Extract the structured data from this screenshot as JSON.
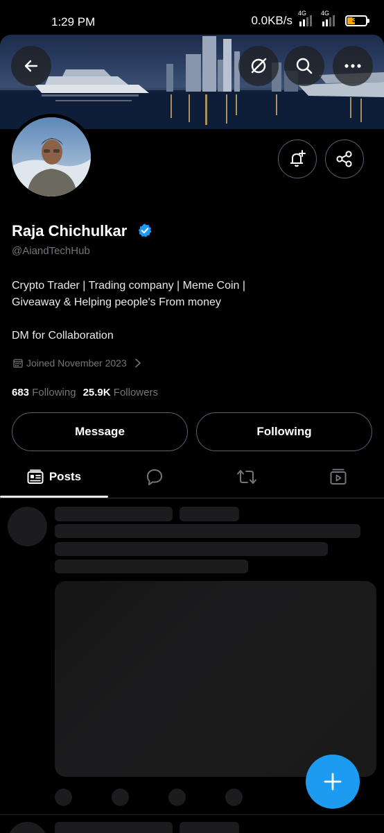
{
  "status_bar": {
    "time": "1:29 PM",
    "speed": "0.0KB/s",
    "network1": "4G",
    "network2": "4G",
    "battery": "35"
  },
  "header": {
    "back_icon": "arrow-left-icon",
    "grok_icon": "grok-icon",
    "search_icon": "search-icon",
    "more_icon": "more-horizontal-icon"
  },
  "profile": {
    "display_name": "Raja Chichulkar",
    "handle": "@AiandTechHub",
    "bio_line1": "Crypto Trader | Trading company | Meme Coin |",
    "bio_line2": "Giveaway & Helping people's From money",
    "bio_line3": "DM for Collaboration",
    "joined": "Joined November 2023",
    "following_count": "683",
    "following_label": "Following",
    "followers_count": "25.9K",
    "followers_label": "Followers"
  },
  "actions": {
    "message_label": "Message",
    "following_label": "Following"
  },
  "tabs": {
    "posts_label": "Posts"
  },
  "colors": {
    "accent": "#1d9bf0",
    "background": "#000000",
    "muted_text": "#71767b"
  }
}
